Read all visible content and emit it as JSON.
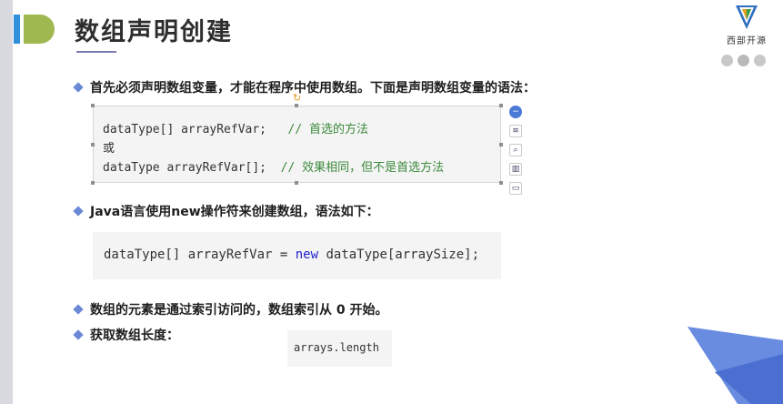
{
  "title": "数组声明创建",
  "logo": {
    "text": "西部开源"
  },
  "bullets": [
    "首先必须声明数组变量，才能在程序中使用数组。下面是声明数组变量的语法：",
    "Java语言使用new操作符来创建数组，语法如下：",
    "数组的元素是通过索引访问的，数组索引从 0 开始。",
    "获取数组长度："
  ],
  "code1": {
    "line1_code": "dataType[] arrayRefVar;   ",
    "line1_comment": "// 首选的方法",
    "line2": "或",
    "line3_code": "dataType arrayRefVar[];  ",
    "line3_comment": "// 效果相同，但不是首选方法"
  },
  "code2": {
    "part1": "dataType[] arrayRefVar = ",
    "keyword": "new",
    "part2": " dataType[arraySize];"
  },
  "code3": {
    "text": "arrays.length"
  },
  "colors": {
    "accent_blue": "#2f8fd9",
    "accent_green": "#9fb84f",
    "comment_green": "#3d8a3d",
    "keyword_blue": "#2222cc"
  }
}
